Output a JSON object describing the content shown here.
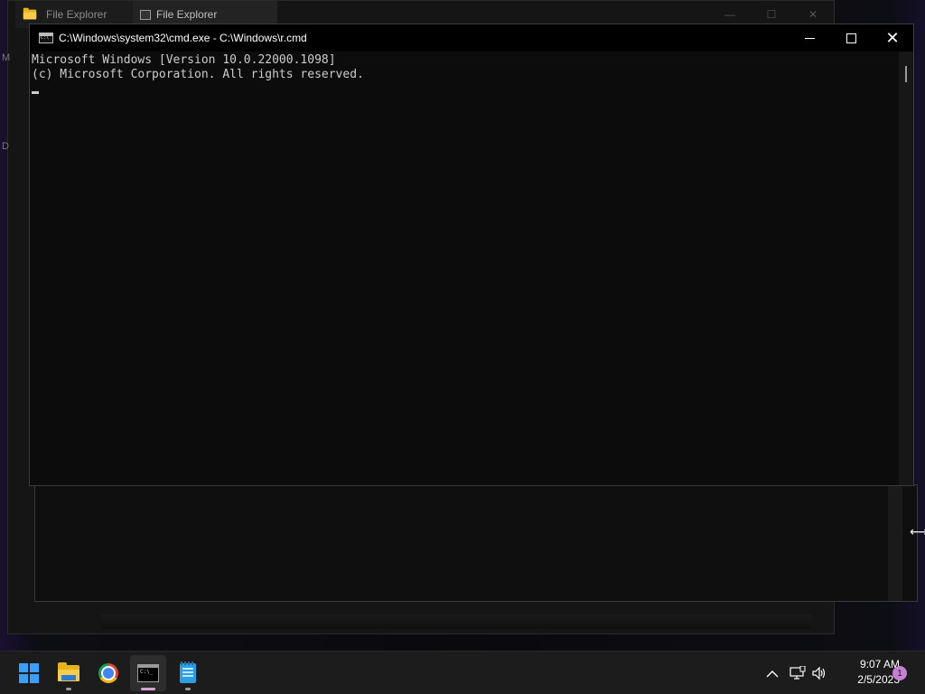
{
  "background_window": {
    "tabs": [
      {
        "label": "File Explorer",
        "icon": "folder-icon"
      },
      {
        "label": "File Explorer",
        "icon": "explorer-window-icon"
      }
    ],
    "side_chars": [
      "M",
      "D"
    ]
  },
  "cmd_window": {
    "title": "C:\\Windows\\system32\\cmd.exe - C:\\Windows\\r.cmd",
    "controls": {
      "minimize": "minimize-icon",
      "maximize": "maximize-icon",
      "close": "close-icon"
    },
    "console_lines": [
      "Microsoft Windows [Version 10.0.22000.1098]",
      "(c) Microsoft Corporation. All rights reserved."
    ],
    "console_colors": {
      "background": "#0c0c0c",
      "text": "#cccccc"
    }
  },
  "taskbar": {
    "apps": [
      {
        "name": "Start",
        "icon": "windows-start-icon"
      },
      {
        "name": "File Explorer",
        "icon": "folder-icon"
      },
      {
        "name": "Google Chrome",
        "icon": "chrome-icon"
      },
      {
        "name": "Command Prompt",
        "icon": "terminal-icon",
        "active": true
      },
      {
        "name": "Notepad",
        "icon": "notepad-icon"
      }
    ],
    "tray": {
      "icons": [
        "chevron-up-icon",
        "network-icon",
        "volume-icon"
      ],
      "time": "9:07 AM",
      "date": "2/5/2023",
      "notification_count": "1"
    },
    "accent": "#d8a0d0"
  }
}
